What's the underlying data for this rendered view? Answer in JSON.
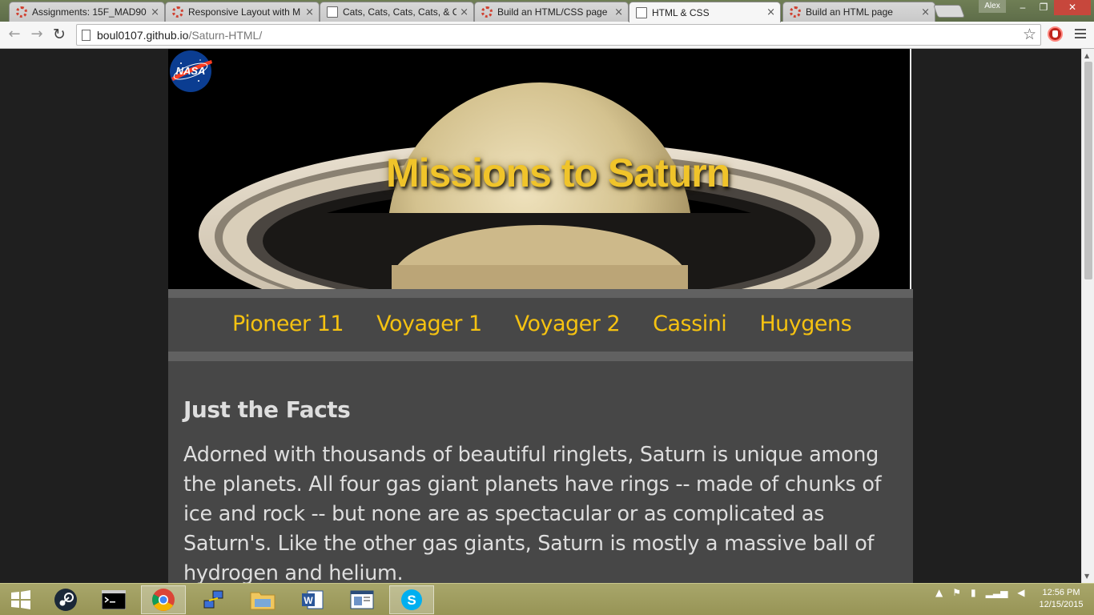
{
  "browser": {
    "tabs": [
      {
        "title": "Assignments: 15F_MAD90",
        "icon": "loading-ring-icon",
        "active": false
      },
      {
        "title": "Responsive Layout with M",
        "icon": "loading-ring-icon",
        "active": false
      },
      {
        "title": "Cats, Cats, Cats, Cats, & Ca",
        "icon": "page-icon",
        "active": false
      },
      {
        "title": "Build an HTML/CSS page",
        "icon": "loading-ring-icon",
        "active": false
      },
      {
        "title": "HTML & CSS",
        "icon": "page-icon",
        "active": true
      },
      {
        "title": "Build an HTML page",
        "icon": "loading-ring-icon",
        "active": false
      }
    ],
    "close_glyph": "×",
    "profile_name": "Alex",
    "window_controls": {
      "minimize": "–",
      "maximize": "❐",
      "close": "✕"
    },
    "nav": {
      "back": "←",
      "forward": "→",
      "reload": "↻"
    },
    "url_host": "boul0107.github.io",
    "url_path": "/Saturn-HTML/",
    "bookmark_star": "☆"
  },
  "page": {
    "hero_title": "Missions to Saturn",
    "logo_text": "NASA",
    "nav_links": [
      "Pioneer 11",
      "Voyager 1",
      "Voyager 2",
      "Cassini",
      "Huygens"
    ],
    "section_heading": "Just the Facts",
    "section_body": "Adorned with thousands of beautiful ringlets, Saturn is unique among the planets. All four gas giant planets have rings -- made of chunks of ice and rock -- but none are as spectacular or as complicated as Saturn's. Like the other gas giants, Saturn is mostly a massive ball of hydrogen and helium.",
    "colors": {
      "accent": "#f5c211",
      "panel": "#474747",
      "band": "#616161",
      "background": "#1f1f1f"
    }
  },
  "taskbar": {
    "apps": [
      "windows-start-icon",
      "steam-icon",
      "command-prompt-icon",
      "chrome-icon",
      "network-tool-icon",
      "file-explorer-icon",
      "word-icon",
      "reader-icon",
      "skype-icon"
    ],
    "active_app": "chrome-icon",
    "clock_time": "12:56 PM",
    "clock_date": "12/15/2015"
  }
}
